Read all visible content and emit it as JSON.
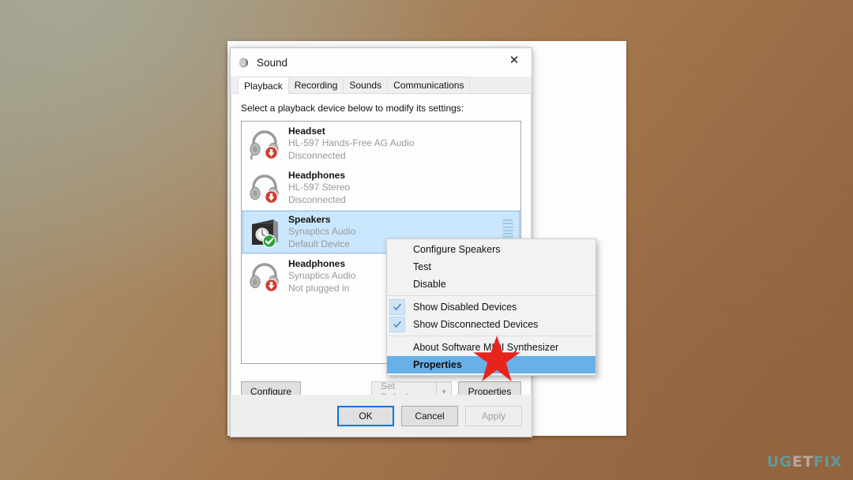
{
  "desktop": {
    "background_colors": [
      "#9a9a86",
      "#a78963",
      "#a5784f",
      "#8e6039"
    ],
    "watermark": {
      "part1": "UG",
      "part2": "ET",
      "part3": "FIX",
      "accent": "#5f9ea0"
    }
  },
  "dialog": {
    "title": "Sound",
    "title_icon": "speaker-icon",
    "close_label": "✕",
    "tabs": [
      {
        "label": "Playback",
        "active": true
      },
      {
        "label": "Recording",
        "active": false
      },
      {
        "label": "Sounds",
        "active": false
      },
      {
        "label": "Communications",
        "active": false
      }
    ],
    "prompt": "Select a playback device below to modify its settings:",
    "devices": [
      {
        "name": "Headset",
        "description": "HL-597 Hands-Free AG Audio",
        "status": "Disconnected",
        "icon": "headset-icon",
        "badge": "down-arrow-badge",
        "selected": false,
        "meter": false
      },
      {
        "name": "Headphones",
        "description": "HL-597 Stereo",
        "status": "Disconnected",
        "icon": "headphones-icon",
        "badge": "down-arrow-badge",
        "selected": false,
        "meter": false
      },
      {
        "name": "Speakers",
        "description": "Synaptics Audio",
        "status": "Default Device",
        "icon": "speaker-box-icon",
        "badge": "green-check-badge",
        "selected": true,
        "meter": true
      },
      {
        "name": "Headphones",
        "description": "Synaptics Audio",
        "status": "Not plugged in",
        "icon": "headphones-icon",
        "badge": "down-arrow-badge",
        "selected": false,
        "meter": false
      }
    ],
    "mid_buttons": {
      "configure": "Configure",
      "set_default": "Set Default",
      "set_default_disabled": true,
      "dropdown_arrow": "▼",
      "properties": "Properties"
    },
    "footer_buttons": {
      "ok": "OK",
      "cancel": "Cancel",
      "apply": "Apply",
      "apply_disabled": true
    }
  },
  "context_menu": {
    "items": [
      {
        "label": "Configure Speakers",
        "checked": false,
        "highlight": false
      },
      {
        "label": "Test",
        "checked": false,
        "highlight": false
      },
      {
        "label": "Disable",
        "checked": false,
        "highlight": false
      },
      {
        "label": "Show Disabled Devices",
        "checked": true,
        "highlight": false
      },
      {
        "label": "Show Disconnected Devices",
        "checked": true,
        "highlight": false
      },
      {
        "label": "About Software MIDI Synthesizer",
        "checked": false,
        "highlight": false
      },
      {
        "label": "Properties",
        "checked": false,
        "highlight": true
      }
    ]
  },
  "annotation": {
    "shape": "red-star",
    "color": "#e8231e"
  }
}
